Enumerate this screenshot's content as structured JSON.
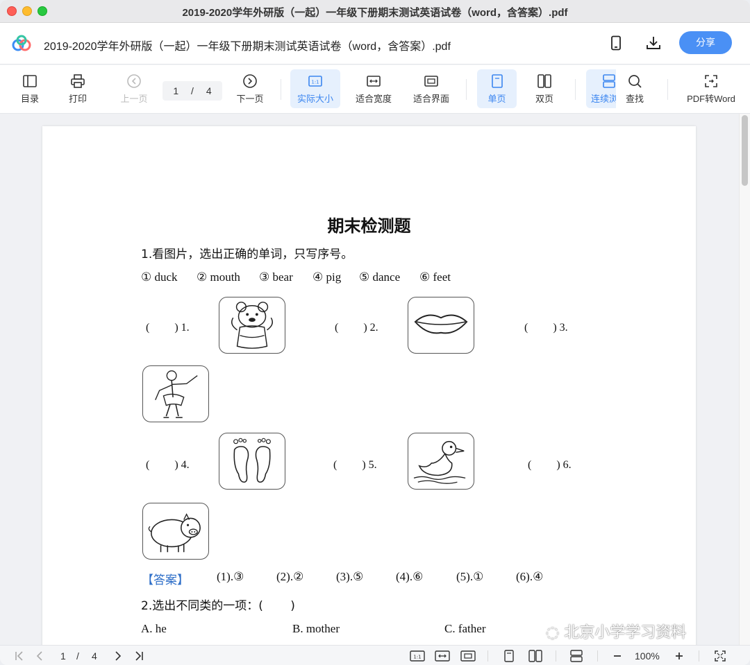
{
  "window": {
    "title": "2019-2020学年外研版（一起）一年级下册期末测试英语试卷（word，含答案）.pdf"
  },
  "header": {
    "doc_title": "2019-2020学年外研版（一起）一年级下册期末测试英语试卷（word，含答案）.pdf",
    "share_label": "分享",
    "icons": [
      "phone-icon",
      "download-icon"
    ]
  },
  "toolbar": {
    "toc": "目录",
    "print": "打印",
    "prev_page": "上一页",
    "page_current": "1",
    "page_sep": "/",
    "page_total": "4",
    "next_page": "下一页",
    "actual_size": "实际大小",
    "fit_width": "适合宽度",
    "fit_screen": "适合界面",
    "single_page": "单页",
    "double_page": "双页",
    "continuous": "连续浏",
    "find": "查找",
    "pdf_to_word": "PDF转Word"
  },
  "document": {
    "title": "期末检测题",
    "q1": {
      "instruction": "1.看图片，选出正确的单词，只写序号。",
      "options": [
        "① duck",
        "② mouth",
        "③ bear",
        "④ pig",
        "⑤ dance",
        "⑥ feet"
      ],
      "items": [
        "(　　 ) 1.",
        "(　　 ) 2.",
        "(　　 ) 3.",
        "(　　 ) 4.",
        "(　　 ) 5.",
        "(　　 ) 6."
      ],
      "pictures": [
        "bear",
        "mouth",
        "dance",
        "feet",
        "duck",
        "pig"
      ],
      "answer_label": "【答案】",
      "answers": [
        "(1).③",
        "(2).②",
        "(3).⑤",
        "(4).⑥",
        "(5).①",
        "(6).④"
      ]
    },
    "q2": {
      "instruction": "2.选出不同类的一项：(　　 )",
      "choices": [
        "A.  he",
        "B.  mother",
        "C.  father"
      ]
    }
  },
  "watermark": "北京小学学习资料",
  "bottombar": {
    "page_current": "1",
    "page_sep": "/",
    "page_total": "4",
    "zoom": "100%"
  },
  "colors": {
    "accent": "#3a85f0",
    "share_button": "#4a90f5",
    "answer_label": "#2f6fc8"
  }
}
